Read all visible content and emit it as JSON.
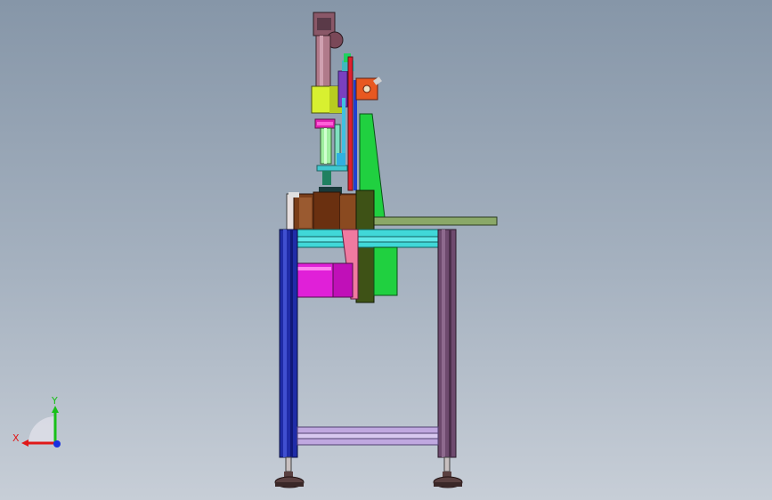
{
  "triad": {
    "x_label": "X",
    "y_label": "Y",
    "colors": {
      "x": "#e01818",
      "y": "#18c018",
      "z": "#1830e0"
    }
  },
  "model_colors": {
    "background_top": "#8696a8",
    "background_bottom": "#c7ced7",
    "left_leg": "#1f2ca8",
    "right_leg": "#6e4a6e",
    "cross_bar": "#c0a8e0",
    "cyan_rails": "#40d8d8",
    "motor": "#e020d8",
    "green_panel": "#20d040",
    "pink_plate": "#f07aa0",
    "drum": "#7a3e1a",
    "wheel": "#3e5216",
    "table_top": "#8aa868",
    "cylinder": "#b07a8a",
    "yellow_block": "#d8f030",
    "lime_rod": "#a0f0a0",
    "feet": "#5a4040"
  }
}
